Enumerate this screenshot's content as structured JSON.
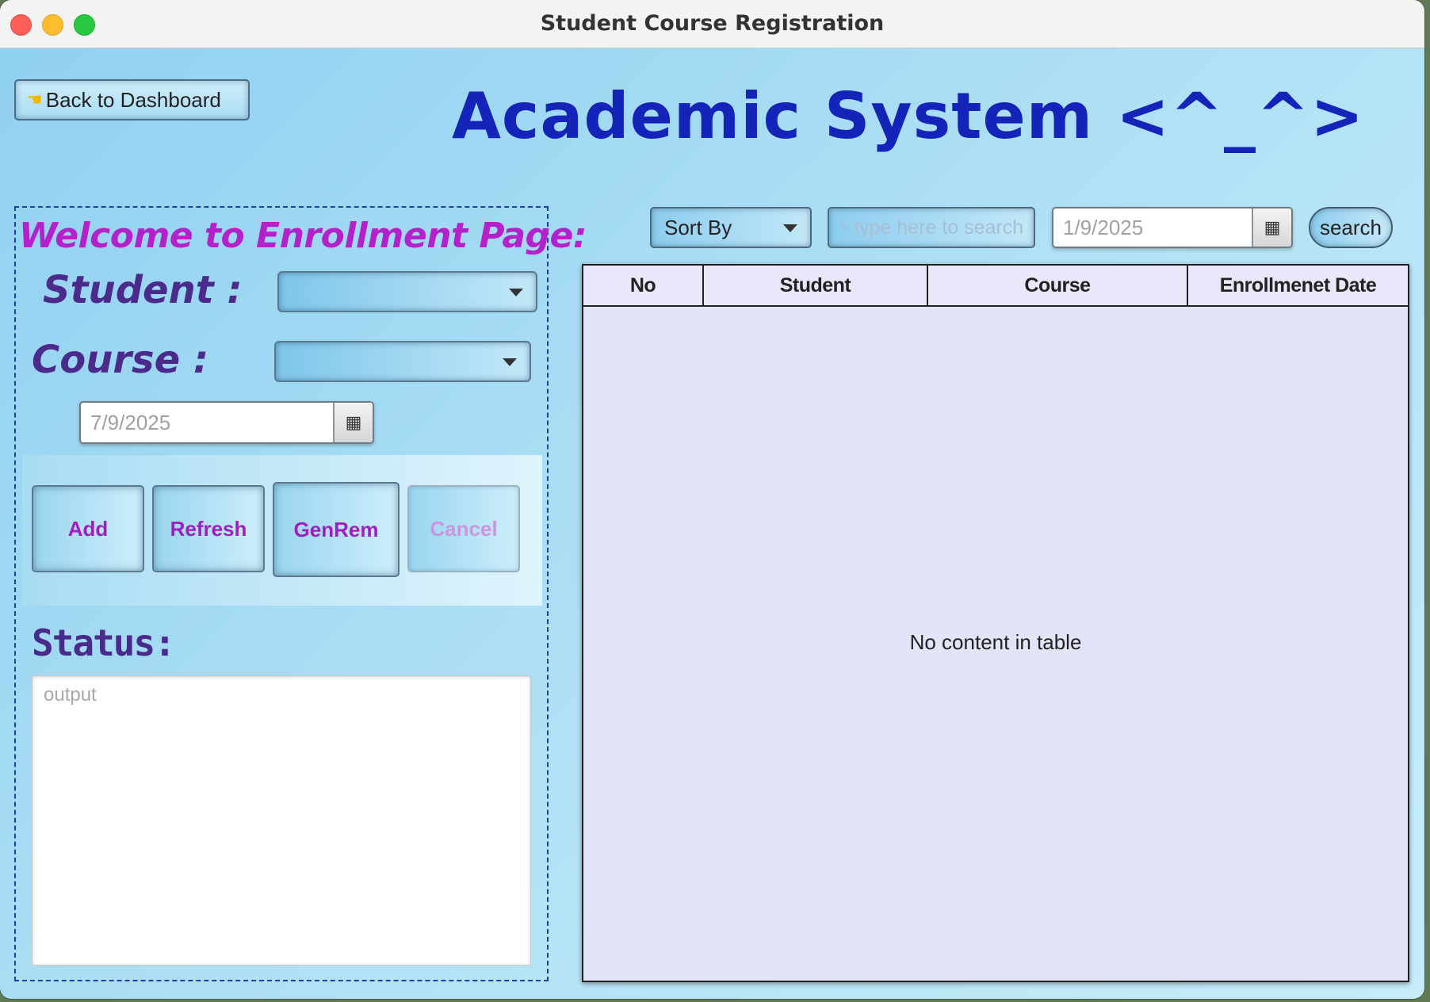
{
  "window": {
    "title": "Student Course Registration"
  },
  "header": {
    "back_label": "Back to Dashboard",
    "app_title": "Academic System <^_^>"
  },
  "form": {
    "welcome": "Welcome to Enrollment Page:",
    "student_label": "Student :",
    "course_label": "Course :",
    "date_value": "7/9/2025",
    "buttons": {
      "add": "Add",
      "refresh": "Refresh",
      "genrem": "GenRem",
      "cancel": "Cancel"
    },
    "status_label": "Status:",
    "output_placeholder": "output"
  },
  "toolbar": {
    "sort_label": "Sort By",
    "search_placeholder": "type here to search",
    "date_value": "1/9/2025",
    "search_label": "search"
  },
  "table": {
    "columns": [
      "No",
      "Student",
      "Course",
      "Enrollmenet Date"
    ],
    "empty_text": "No content in table"
  },
  "colors": {
    "title": "#1423b8",
    "welcome": "#b420c9",
    "label": "#4a2a8a",
    "button_text": "#a21cbf"
  }
}
